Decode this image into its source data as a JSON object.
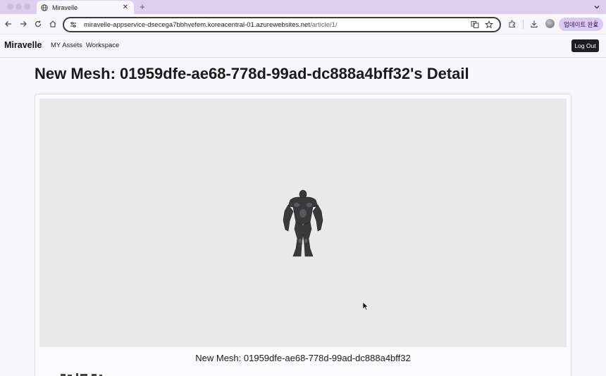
{
  "browser": {
    "tab_title": "Miravelle",
    "url_host": "miravelle-appservice-dsecega7bbhvefem.koreacentral-01.azurewebsites.net",
    "url_path": "/article/1/",
    "update_button_label": "업데이트 완료",
    "icons": [
      "globe-icon",
      "close-icon",
      "plus-icon",
      "chevron-down-icon",
      "back-icon",
      "forward-icon",
      "reload-icon",
      "home-icon",
      "tune-icon",
      "translate-icon",
      "star-icon",
      "extensions-icon",
      "download-icon",
      "profile-avatar",
      "more-vert-icon"
    ]
  },
  "navbar": {
    "brand": "Miravelle",
    "links": [
      "MY Assets",
      "Workspace"
    ],
    "logout_label": "Log Out"
  },
  "main": {
    "title": "New Mesh: 01959dfe-ae68-778d-99ad-dc888a4bff32's Detail",
    "caption": "New Mesh: 01959dfe-ae68-778d-99ad-dc888a4bff32"
  },
  "colors": {
    "tab_strip": "#dccff0",
    "viewer_bg": "#e9e9ea",
    "logout_bg": "#1e1e22",
    "update_button_bg": "#d9c8f3"
  }
}
